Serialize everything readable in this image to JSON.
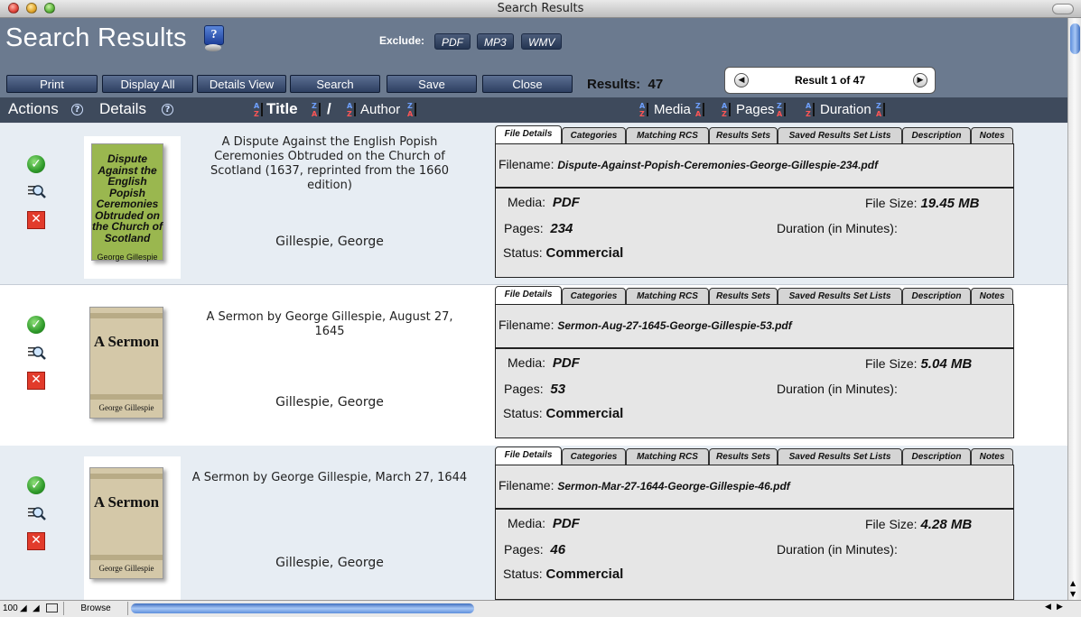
{
  "window": {
    "title": "Search Results"
  },
  "header": {
    "title": "Search Results",
    "exclude_label": "Exclude:",
    "exclude_buttons": [
      "PDF",
      "MP3",
      "WMV"
    ],
    "buttons": {
      "print": "Print",
      "display_all": "Display All",
      "details_view": "Details View",
      "search": "Search",
      "save": "Save",
      "close": "Close"
    },
    "results_label": "Results:",
    "results_count": "47",
    "pager_text": "Result 1 of 47"
  },
  "columns": {
    "actions": "Actions",
    "details": "Details",
    "title": "Title",
    "slash": "/",
    "author": "Author",
    "media": "Media",
    "pages": "Pages",
    "duration": "Duration"
  },
  "tabs": [
    "File Details",
    "Categories",
    "Matching RCS",
    "Results Sets",
    "Saved Results Set Lists",
    "Description",
    "Notes"
  ],
  "labels": {
    "filename": "Filename:",
    "media": "Media:",
    "pages": "Pages:",
    "status": "Status:",
    "file_size": "File Size:",
    "duration": "Duration (in Minutes):"
  },
  "results": [
    {
      "title": "A Dispute Against the English Popish Ceremonies Obtruded on the Church of Scotland (1637, reprinted from the 1660 edition)",
      "author": "Gillespie, George",
      "filename": "Dispute-Against-Popish-Ceremonies-George-Gillespie-234.pdf",
      "media": "PDF",
      "pages": "234",
      "status": "Commercial",
      "file_size": "19.45 MB",
      "cover_title": "Dispute Against the English Popish Ceremonies Obtruded on the Church of Scotland",
      "cover_author": "George Gillespie"
    },
    {
      "title": "A Sermon by George Gillespie, August 27, 1645",
      "author": "Gillespie, George",
      "filename": "Sermon-Aug-27-1645-George-Gillespie-53.pdf",
      "media": "PDF",
      "pages": "53",
      "status": "Commercial",
      "file_size": "5.04 MB",
      "cover_title": "A Sermon",
      "cover_author": "George Gillespie"
    },
    {
      "title": "A Sermon by George Gillespie, March 27, 1644",
      "author": "Gillespie, George",
      "filename": "Sermon-Mar-27-1644-George-Gillespie-46.pdf",
      "media": "PDF",
      "pages": "46",
      "status": "Commercial",
      "file_size": "4.28 MB",
      "cover_title": "A Sermon",
      "cover_author": "George Gillespie"
    }
  ],
  "statusbar": {
    "zoom": "100",
    "mode": "Browse"
  },
  "colors": {
    "header_bg": "#6b7a8f",
    "column_bar_bg": "#3e4a5c",
    "row_alt_bg": "#e7edf3",
    "row_bg": "#ffffff"
  }
}
